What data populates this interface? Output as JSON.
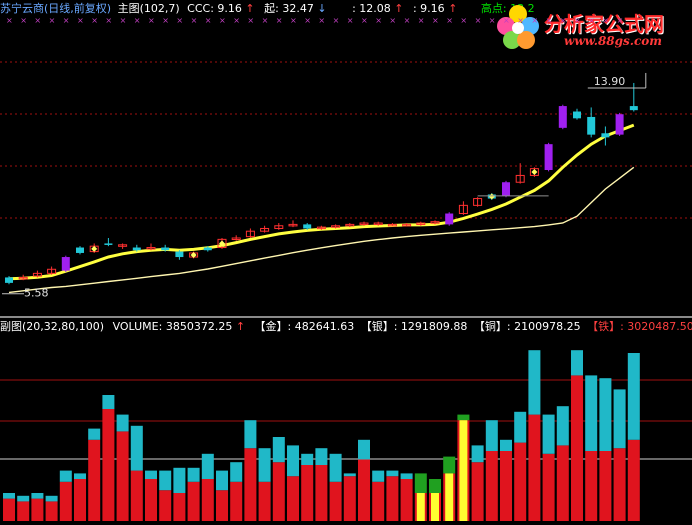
{
  "main_header": {
    "stock_label": "苏宁云商(日线,前复权)",
    "chart_label": "主图(102,7)",
    "ccc_label": "CCC: 9.16",
    "start_label": "起: 32.47",
    "v2_label": ": 12.08",
    "v3_label": ": 9.16",
    "high_label": "高点: 13.2"
  },
  "watermark": {
    "brand": "分析家公式网",
    "url": "www.88gs.com"
  },
  "sub_header": {
    "label": "副图(20,32,80,100)",
    "volume": "VOLUME: 3850372.25",
    "gold": "【金】: 482641.63",
    "silver": "【银】: 1291809.88",
    "copper": "【铜】: 2100978.25",
    "iron": "【铁】: 3020487.50"
  },
  "chart_annotations": {
    "high_price": "13.90",
    "low_price": "5.58"
  },
  "colors": {
    "header_blue": "#6aa8ff",
    "header_white": "#ffffff",
    "header_red": "#ff4040",
    "header_green": "#00e000",
    "purple_candle": "#a020f0",
    "cyan_candle": "#22c8d8",
    "yellow_ma": "#ffff40",
    "red_bar": "#e0141e",
    "cyan_bar": "#20b8c8",
    "green_bar": "#20a020",
    "yellow_bar": "#ffff30",
    "grid_red": "#a01010"
  },
  "chart_data": [
    {
      "type": "candlestick",
      "title": "苏宁云商(日线,前复权)",
      "candles": [
        {
          "o": 5.85,
          "c": 6.05,
          "h": 6.1,
          "l": 5.8,
          "color": "cyan"
        },
        {
          "o": 6.0,
          "c": 6.05,
          "h": 6.15,
          "l": 5.95,
          "color": "red"
        },
        {
          "o": 6.1,
          "c": 6.2,
          "h": 6.3,
          "l": 6.05,
          "color": "red"
        },
        {
          "o": 6.2,
          "c": 6.35,
          "h": 6.45,
          "l": 6.15,
          "color": "red"
        },
        {
          "o": 6.3,
          "c": 6.8,
          "h": 6.85,
          "l": 6.25,
          "color": "purple"
        },
        {
          "o": 6.95,
          "c": 7.15,
          "h": 7.2,
          "l": 6.9,
          "color": "cyan"
        },
        {
          "o": 7.0,
          "c": 7.2,
          "h": 7.3,
          "l": 6.95,
          "color": "red"
        },
        {
          "o": 7.25,
          "c": 7.3,
          "h": 7.5,
          "l": 7.2,
          "color": "cyan"
        },
        {
          "o": 7.2,
          "c": 7.25,
          "h": 7.3,
          "l": 7.1,
          "color": "red"
        },
        {
          "o": 7.15,
          "c": 7.05,
          "h": 7.25,
          "l": 7.0,
          "color": "cyan"
        },
        {
          "o": 7.1,
          "c": 7.15,
          "h": 7.3,
          "l": 7.05,
          "color": "red"
        },
        {
          "o": 7.15,
          "c": 7.05,
          "h": 7.25,
          "l": 7.0,
          "color": "cyan"
        },
        {
          "o": 7.0,
          "c": 6.8,
          "h": 7.05,
          "l": 6.7,
          "color": "cyan"
        },
        {
          "o": 6.8,
          "c": 6.95,
          "h": 7.0,
          "l": 6.75,
          "color": "red"
        },
        {
          "o": 7.05,
          "c": 7.15,
          "h": 7.2,
          "l": 7.0,
          "color": "cyan"
        },
        {
          "o": 7.15,
          "c": 7.45,
          "h": 7.5,
          "l": 7.1,
          "color": "red"
        },
        {
          "o": 7.45,
          "c": 7.5,
          "h": 7.6,
          "l": 7.4,
          "color": "red"
        },
        {
          "o": 7.55,
          "c": 7.75,
          "h": 7.85,
          "l": 7.5,
          "color": "red"
        },
        {
          "o": 7.75,
          "c": 7.85,
          "h": 7.95,
          "l": 7.7,
          "color": "red"
        },
        {
          "o": 7.85,
          "c": 7.95,
          "h": 8.05,
          "l": 7.8,
          "color": "red"
        },
        {
          "o": 7.95,
          "c": 8.0,
          "h": 8.15,
          "l": 7.9,
          "color": "red"
        },
        {
          "o": 8.0,
          "c": 7.85,
          "h": 8.05,
          "l": 7.8,
          "color": "cyan"
        },
        {
          "o": 7.85,
          "c": 7.9,
          "h": 7.95,
          "l": 7.8,
          "color": "red"
        },
        {
          "o": 7.9,
          "c": 7.95,
          "h": 8.0,
          "l": 7.85,
          "color": "red"
        },
        {
          "o": 7.95,
          "c": 8.0,
          "h": 8.05,
          "l": 7.9,
          "color": "red"
        },
        {
          "o": 8.0,
          "c": 8.05,
          "h": 8.1,
          "l": 7.95,
          "color": "red"
        },
        {
          "o": 8.05,
          "c": 8.0,
          "h": 8.1,
          "l": 7.95,
          "color": "red"
        },
        {
          "o": 8.0,
          "c": 8.0,
          "h": 8.05,
          "l": 7.95,
          "color": "red"
        },
        {
          "o": 8.0,
          "c": 8.0,
          "h": 8.05,
          "l": 7.95,
          "color": "red"
        },
        {
          "o": 8.0,
          "c": 8.05,
          "h": 8.1,
          "l": 7.95,
          "color": "red"
        },
        {
          "o": 8.05,
          "c": 8.1,
          "h": 8.15,
          "l": 8.0,
          "color": "red"
        },
        {
          "o": 8.0,
          "c": 8.4,
          "h": 8.45,
          "l": 7.95,
          "color": "purple"
        },
        {
          "o": 8.4,
          "c": 8.7,
          "h": 8.85,
          "l": 8.35,
          "color": "red"
        },
        {
          "o": 8.7,
          "c": 8.95,
          "h": 9.0,
          "l": 8.65,
          "color": "red"
        },
        {
          "o": 8.95,
          "c": 9.1,
          "h": 9.15,
          "l": 8.9,
          "color": "cyan"
        },
        {
          "o": 9.05,
          "c": 9.55,
          "h": 9.6,
          "l": 9.0,
          "color": "purple"
        },
        {
          "o": 9.55,
          "c": 9.8,
          "h": 10.25,
          "l": 9.5,
          "color": "red"
        },
        {
          "o": 9.8,
          "c": 10.05,
          "h": 10.1,
          "l": 9.75,
          "color": "red"
        },
        {
          "o": 10.0,
          "c": 10.95,
          "h": 11.0,
          "l": 9.95,
          "color": "purple"
        },
        {
          "o": 11.55,
          "c": 12.35,
          "h": 12.4,
          "l": 11.5,
          "color": "purple"
        },
        {
          "o": 12.15,
          "c": 11.9,
          "h": 12.25,
          "l": 11.85,
          "color": "cyan"
        },
        {
          "o": 11.95,
          "c": 11.3,
          "h": 12.3,
          "l": 11.2,
          "color": "cyan"
        },
        {
          "o": 11.35,
          "c": 11.2,
          "h": 11.6,
          "l": 10.9,
          "color": "cyan"
        },
        {
          "o": 11.3,
          "c": 12.05,
          "h": 12.1,
          "l": 11.25,
          "color": "purple"
        },
        {
          "o": 12.2,
          "c": 12.35,
          "h": 13.2,
          "l": 12.15,
          "color": "cyan"
        }
      ],
      "diamond_markers": [
        6,
        13,
        15,
        34,
        37
      ],
      "ma_short": [
        6.0,
        6.02,
        6.06,
        6.12,
        6.28,
        6.45,
        6.62,
        6.8,
        6.92,
        7.0,
        7.05,
        7.08,
        7.05,
        7.08,
        7.14,
        7.22,
        7.33,
        7.45,
        7.55,
        7.65,
        7.72,
        7.78,
        7.82,
        7.85,
        7.88,
        7.92,
        7.94,
        7.96,
        7.98,
        7.98,
        8.0,
        8.08,
        8.22,
        8.38,
        8.55,
        8.75,
        9.0,
        9.25,
        9.6,
        10.1,
        10.55,
        10.95,
        11.25,
        11.45,
        11.65
      ],
      "ma_long": [
        5.5,
        5.56,
        5.62,
        5.68,
        5.72,
        5.78,
        5.84,
        5.9,
        5.96,
        6.02,
        6.08,
        6.14,
        6.2,
        6.28,
        6.36,
        6.46,
        6.56,
        6.66,
        6.76,
        6.86,
        6.96,
        7.05,
        7.14,
        7.22,
        7.3,
        7.38,
        7.44,
        7.5,
        7.55,
        7.6,
        7.64,
        7.68,
        7.72,
        7.76,
        7.8,
        7.84,
        7.88,
        7.92,
        7.98,
        8.05,
        8.3,
        8.8,
        9.3,
        9.7,
        10.1
      ],
      "ylim": [
        5.0,
        15.0
      ]
    },
    {
      "type": "bar",
      "title": "副图(20,32,80,100)",
      "volume_bars": [
        {
          "base": 0.8,
          "top": 1.0,
          "color": "cyan"
        },
        {
          "base": 0.7,
          "top": 0.9,
          "color": "cyan"
        },
        {
          "base": 0.8,
          "top": 1.0,
          "color": "cyan"
        },
        {
          "base": 0.7,
          "top": 0.9,
          "color": "cyan"
        },
        {
          "base": 1.4,
          "top": 1.8,
          "color": "cyan"
        },
        {
          "base": 1.5,
          "top": 1.7,
          "color": "cyan"
        },
        {
          "base": 2.9,
          "top": 3.3,
          "color": "cyan"
        },
        {
          "base": 4.0,
          "top": 4.5,
          "color": "cyan"
        },
        {
          "base": 3.2,
          "top": 3.8,
          "color": "cyan"
        },
        {
          "base": 1.8,
          "top": 3.4,
          "color": "cyan"
        },
        {
          "base": 1.5,
          "top": 1.8,
          "color": "cyan"
        },
        {
          "base": 1.1,
          "top": 1.8,
          "color": "cyan"
        },
        {
          "base": 1.0,
          "top": 1.9,
          "color": "cyan"
        },
        {
          "base": 1.4,
          "top": 1.9,
          "color": "cyan"
        },
        {
          "base": 1.5,
          "top": 2.4,
          "color": "cyan"
        },
        {
          "base": 1.1,
          "top": 1.8,
          "color": "cyan"
        },
        {
          "base": 1.4,
          "top": 2.1,
          "color": "cyan"
        },
        {
          "base": 2.6,
          "top": 3.6,
          "color": "cyan"
        },
        {
          "base": 1.4,
          "top": 2.6,
          "color": "cyan"
        },
        {
          "base": 2.1,
          "top": 3.0,
          "color": "cyan"
        },
        {
          "base": 1.6,
          "top": 2.7,
          "color": "cyan"
        },
        {
          "base": 2.0,
          "top": 2.4,
          "color": "cyan"
        },
        {
          "base": 2.0,
          "top": 2.6,
          "color": "cyan"
        },
        {
          "base": 1.4,
          "top": 2.4,
          "color": "cyan"
        },
        {
          "base": 1.6,
          "top": 1.7,
          "color": "cyan"
        },
        {
          "base": 2.2,
          "top": 2.9,
          "color": "cyan"
        },
        {
          "base": 1.4,
          "top": 1.8,
          "color": "cyan"
        },
        {
          "base": 1.6,
          "top": 1.8,
          "color": "cyan"
        },
        {
          "base": 1.5,
          "top": 1.7,
          "color": "cyan"
        },
        {
          "base": 1.0,
          "top": 1.7,
          "color": "green"
        },
        {
          "base": 1.0,
          "top": 1.5,
          "color": "green"
        },
        {
          "base": 1.7,
          "top": 2.3,
          "color": "green"
        },
        {
          "base": 3.6,
          "top": 3.8,
          "color": "green"
        },
        {
          "base": 2.1,
          "top": 2.7,
          "color": "cyan"
        },
        {
          "base": 2.5,
          "top": 3.6,
          "color": "cyan"
        },
        {
          "base": 2.5,
          "top": 2.9,
          "color": "cyan"
        },
        {
          "base": 2.8,
          "top": 3.9,
          "color": "cyan"
        },
        {
          "base": 3.8,
          "top": 6.1,
          "color": "cyan"
        },
        {
          "base": 2.4,
          "top": 3.8,
          "color": "cyan"
        },
        {
          "base": 2.7,
          "top": 4.1,
          "color": "cyan"
        },
        {
          "base": 5.2,
          "top": 6.1,
          "color": "cyan"
        },
        {
          "base": 2.5,
          "top": 5.2,
          "color": "cyan"
        },
        {
          "base": 2.5,
          "top": 5.1,
          "color": "cyan"
        },
        {
          "base": 2.6,
          "top": 4.7,
          "color": "cyan"
        },
        {
          "base": 2.9,
          "top": 6.0,
          "color": "cyan"
        }
      ],
      "yellow_overlay": [
        29,
        30,
        31,
        32
      ],
      "ylim": [
        0,
        6.5
      ]
    }
  ]
}
